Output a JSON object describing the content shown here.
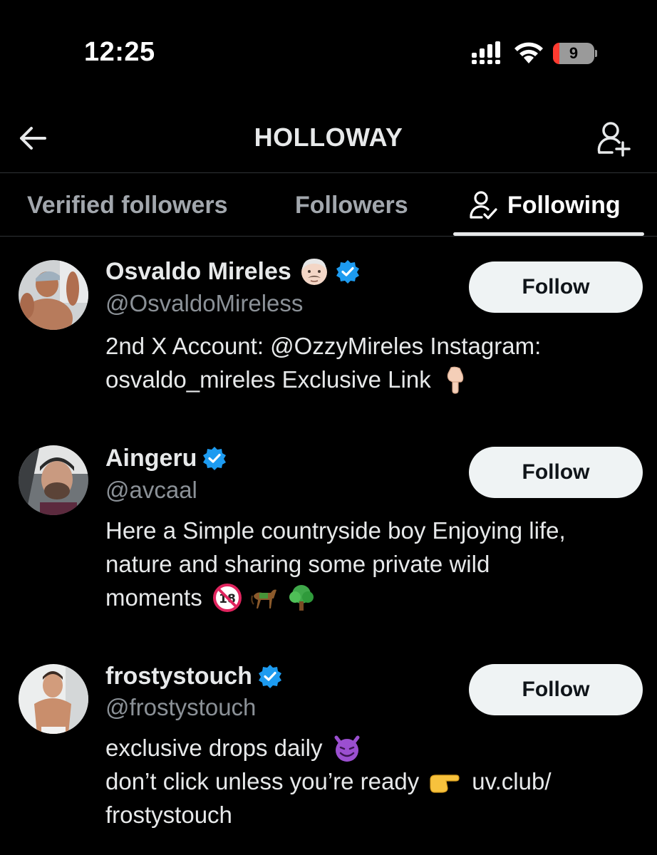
{
  "status_bar": {
    "time": "12:25",
    "battery_level": "9",
    "icons": [
      "cellular-signal-icon",
      "wifi-icon",
      "battery-icon"
    ],
    "battery_low_color": "#ff3b30"
  },
  "header": {
    "title": "HOLLOWAY",
    "back_icon": "arrow-left-icon",
    "add_icon": "add-user-icon"
  },
  "tabs": [
    {
      "label": "Verified followers",
      "active": false
    },
    {
      "label": "Followers",
      "active": false
    },
    {
      "label": "Following",
      "active": true,
      "icon": "person-check-icon"
    }
  ],
  "users": [
    {
      "name": "Osvaldo Mireles",
      "name_emoji": "man-with-mustache-emoji",
      "verified": true,
      "handle": "@OsvaldoMireless",
      "bio_lines": [
        "2nd X Account: @OzzyMireles Instagram:",
        "osvaldo_mireles Exclusive Link"
      ],
      "bio_emojis": [
        "pointing-down-emoji"
      ],
      "follow_label": "Follow"
    },
    {
      "name": "Aingeru",
      "verified": true,
      "handle": "@avcaal",
      "bio_lines": [
        "Here a Simple countryside boy Enjoying life,",
        "nature and sharing some private wild",
        "moments"
      ],
      "bio_emojis": [
        "no-one-under-eighteen-emoji",
        "horse-emoji",
        "tree-emoji"
      ],
      "follow_label": "Follow"
    },
    {
      "name": "frostystouch",
      "verified": true,
      "handle": "@frostystouch",
      "bio_lines": [
        "exclusive drops daily",
        "don’t click unless you’re ready",
        "frostystouch"
      ],
      "bio_link": "uv.club/",
      "bio_emojis": [
        "smiling-devil-emoji",
        "pointing-right-emoji"
      ],
      "follow_label": "Follow"
    }
  ],
  "colors": {
    "background": "#000000",
    "text": "#e7e9ea",
    "secondary_text": "#8b9197",
    "verified_blue": "#1d9bf0",
    "button_bg": "#eff3f4",
    "divider": "#2f3336"
  }
}
